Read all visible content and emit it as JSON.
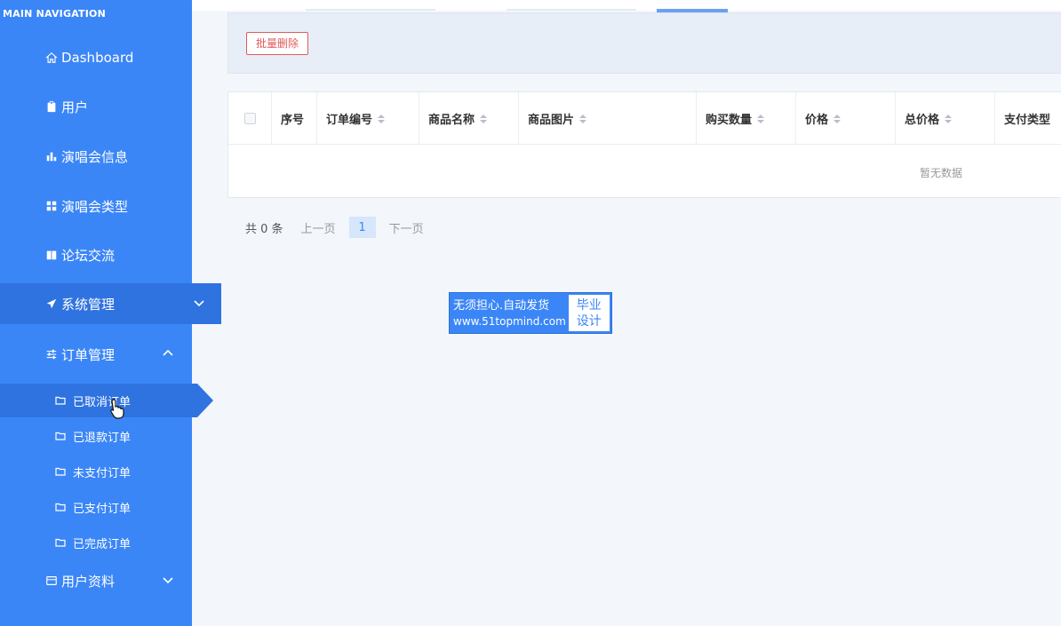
{
  "sidebar": {
    "heading": "MAIN NAVIGATION",
    "items": [
      {
        "label": "Dashboard",
        "icon": "home-icon"
      },
      {
        "label": "用户",
        "icon": "clipboard-icon"
      },
      {
        "label": "演唱会信息",
        "icon": "bar-chart-icon"
      },
      {
        "label": "演唱会类型",
        "icon": "grid-icon"
      },
      {
        "label": "论坛交流",
        "icon": "book-icon"
      },
      {
        "label": "系统管理",
        "icon": "paper-plane-icon"
      },
      {
        "label": "订单管理",
        "icon": "sliders-icon"
      },
      {
        "label": "用户资料",
        "icon": "card-icon"
      }
    ],
    "order_sub_items": [
      {
        "label": "已取消订单"
      },
      {
        "label": "已退款订单"
      },
      {
        "label": "未支付订单"
      },
      {
        "label": "已支付订单"
      },
      {
        "label": "已完成订单"
      }
    ]
  },
  "toolbar": {
    "batch_delete_label": "批量删除"
  },
  "table": {
    "columns": [
      "序号",
      "订单编号",
      "商品名称",
      "商品图片",
      "购买数量",
      "价格",
      "总价格",
      "支付类型"
    ],
    "empty_text": "暂无数据"
  },
  "pager": {
    "total": "共 0 条",
    "prev": "上一页",
    "current": "1",
    "next": "下一页"
  },
  "watermark": {
    "line1": "无须担心.自动发货",
    "line2": "www.51topmind.com",
    "badge_line1": "毕业",
    "badge_line2": "设计"
  },
  "colors": {
    "sidebar_bg": "#3b86f7",
    "sidebar_active": "#2f73e0",
    "danger": "#e05a5a",
    "page_bg": "#f3f6fb"
  }
}
